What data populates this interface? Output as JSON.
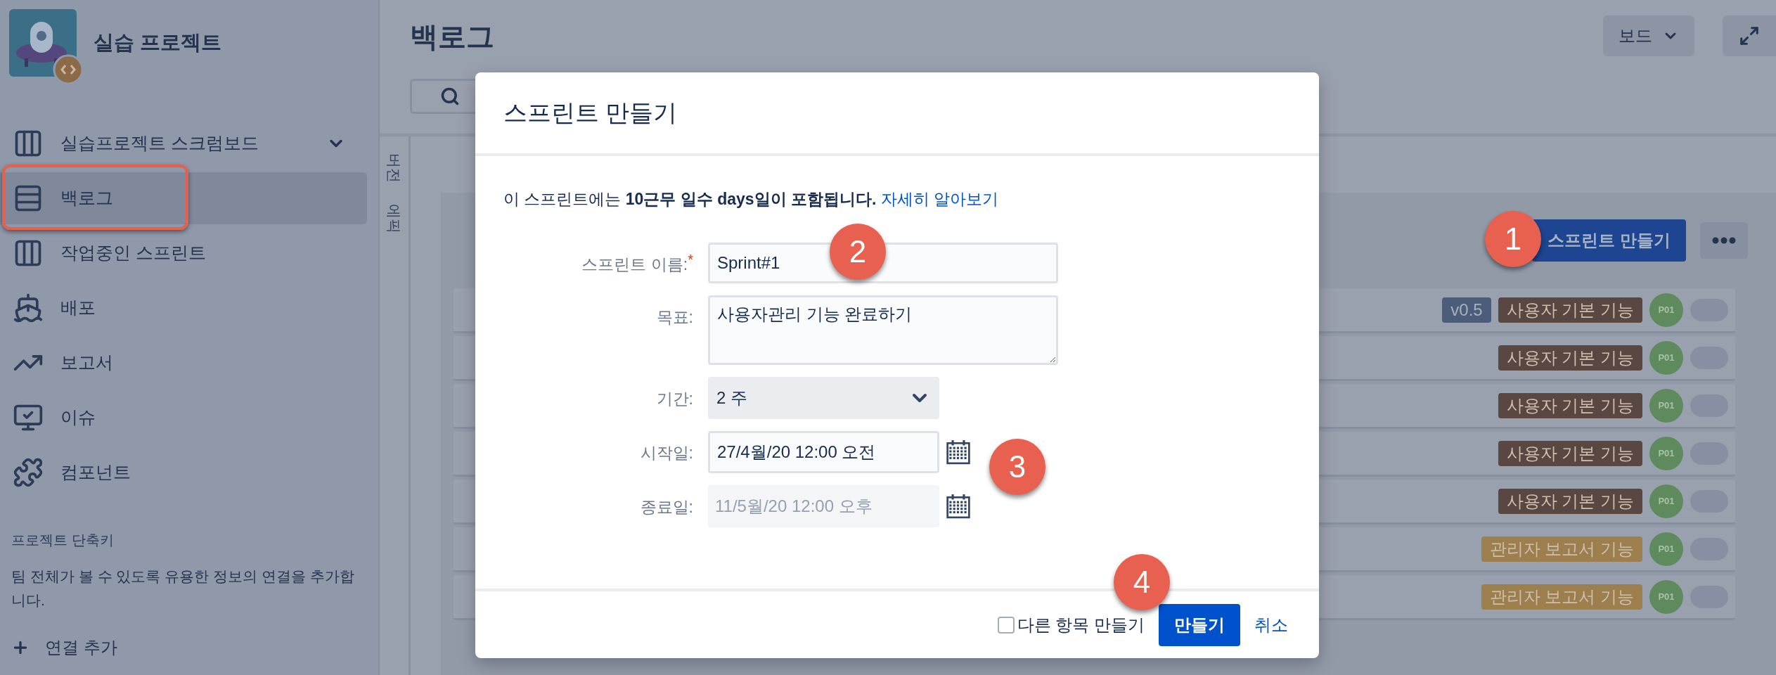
{
  "sidebar": {
    "project_name": "실습 프로젝트",
    "items": [
      {
        "label": "실습프로젝트 스크럼보드",
        "kind": "board",
        "selected": false,
        "highlighted": false,
        "has_menu": true
      },
      {
        "label": "백로그",
        "kind": "backlog",
        "selected": true,
        "highlighted": true,
        "has_menu": false
      },
      {
        "label": "작업중인 스프린트",
        "kind": "sprint",
        "selected": false,
        "highlighted": false,
        "has_menu": false
      },
      {
        "label": "배포",
        "kind": "releases",
        "selected": false,
        "highlighted": false,
        "has_menu": false
      },
      {
        "label": "보고서",
        "kind": "reports",
        "selected": false,
        "highlighted": false,
        "has_menu": false
      },
      {
        "label": "이슈",
        "kind": "issues",
        "selected": false,
        "highlighted": false,
        "has_menu": false
      },
      {
        "label": "컴포넌트",
        "kind": "components",
        "selected": false,
        "highlighted": false,
        "has_menu": false
      }
    ],
    "shortcuts_heading": "프로젝트 단축키",
    "shortcuts_text": "팀 전체가 볼 수 있도록 유용한 정보의 연결을 추가합니다.",
    "add_link": "연결 추가"
  },
  "main": {
    "title": "백로그",
    "board_button": "보드",
    "side_tabs": [
      "버전",
      "에픽"
    ],
    "create_sprint_button": "스프린트 만들기",
    "rows": [
      {
        "version": "v0.5",
        "epic": "사용자 기본 기능",
        "color": "#5b4741",
        "assignee": "P01"
      },
      {
        "epic": "사용자 기본 기능",
        "color": "#5b4741",
        "assignee": "P01"
      },
      {
        "epic": "사용자 기본 기능",
        "color": "#5b4741",
        "assignee": "P01"
      },
      {
        "epic": "사용자 기본 기능",
        "color": "#5b4741",
        "assignee": "P01"
      },
      {
        "epic": "사용자 기본 기능",
        "color": "#5b4741",
        "assignee": "P01"
      },
      {
        "epic": "관리자 보고서 기능",
        "color": "#9d7e4d",
        "assignee": "P01"
      },
      {
        "epic": "관리자 보고서 기능",
        "color": "#9d7e4d",
        "assignee": "P01"
      }
    ]
  },
  "dialog": {
    "title": "스프린트 만들기",
    "info": "이 스프린트에는 **10근무 일수 days일이 포함됩니다.**",
    "info_link": "자세히 알아보기",
    "fields": [
      {
        "label": "스프린트 이름:",
        "kind": "text",
        "required_mark": "*",
        "value": "Sprint#1"
      },
      {
        "label": "목표:",
        "kind": "textarea",
        "value": "사용자관리 기능 완료하기"
      },
      {
        "label": "기간:",
        "kind": "select",
        "value": "2 주"
      },
      {
        "label": "시작일:",
        "kind": "date",
        "value": "27/4월/20 12:00 오전",
        "disabled": false
      },
      {
        "label": "종료일:",
        "kind": "date",
        "value": "11/5월/20 12:00 오후",
        "disabled": true
      }
    ],
    "another_checkbox": {
      "label": "다른 항목 만들기",
      "checked": false
    },
    "submit_button": "만들기",
    "cancel_link": "취소"
  },
  "callouts": [
    {
      "number": "1"
    },
    {
      "number": "2"
    },
    {
      "number": "3"
    },
    {
      "number": "4"
    }
  ]
}
